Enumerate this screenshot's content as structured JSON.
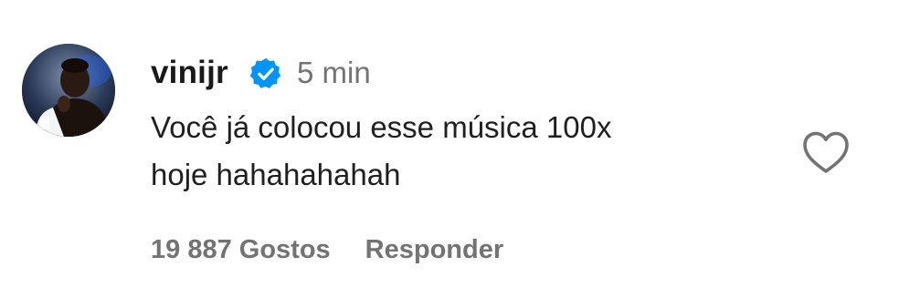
{
  "comment": {
    "username": "vinijr",
    "verified_icon": "verified-badge-icon",
    "timestamp": "5 min",
    "text": "Você já colocou esse música 100x\nhoje hahahahahah",
    "likes_label": "19 887 Gostos",
    "reply_label": "Responder",
    "like_icon": "heart-outline-icon"
  },
  "colors": {
    "verified_blue": "#0095f6",
    "muted_text": "#737373",
    "primary_text": "#1f1f1f"
  }
}
